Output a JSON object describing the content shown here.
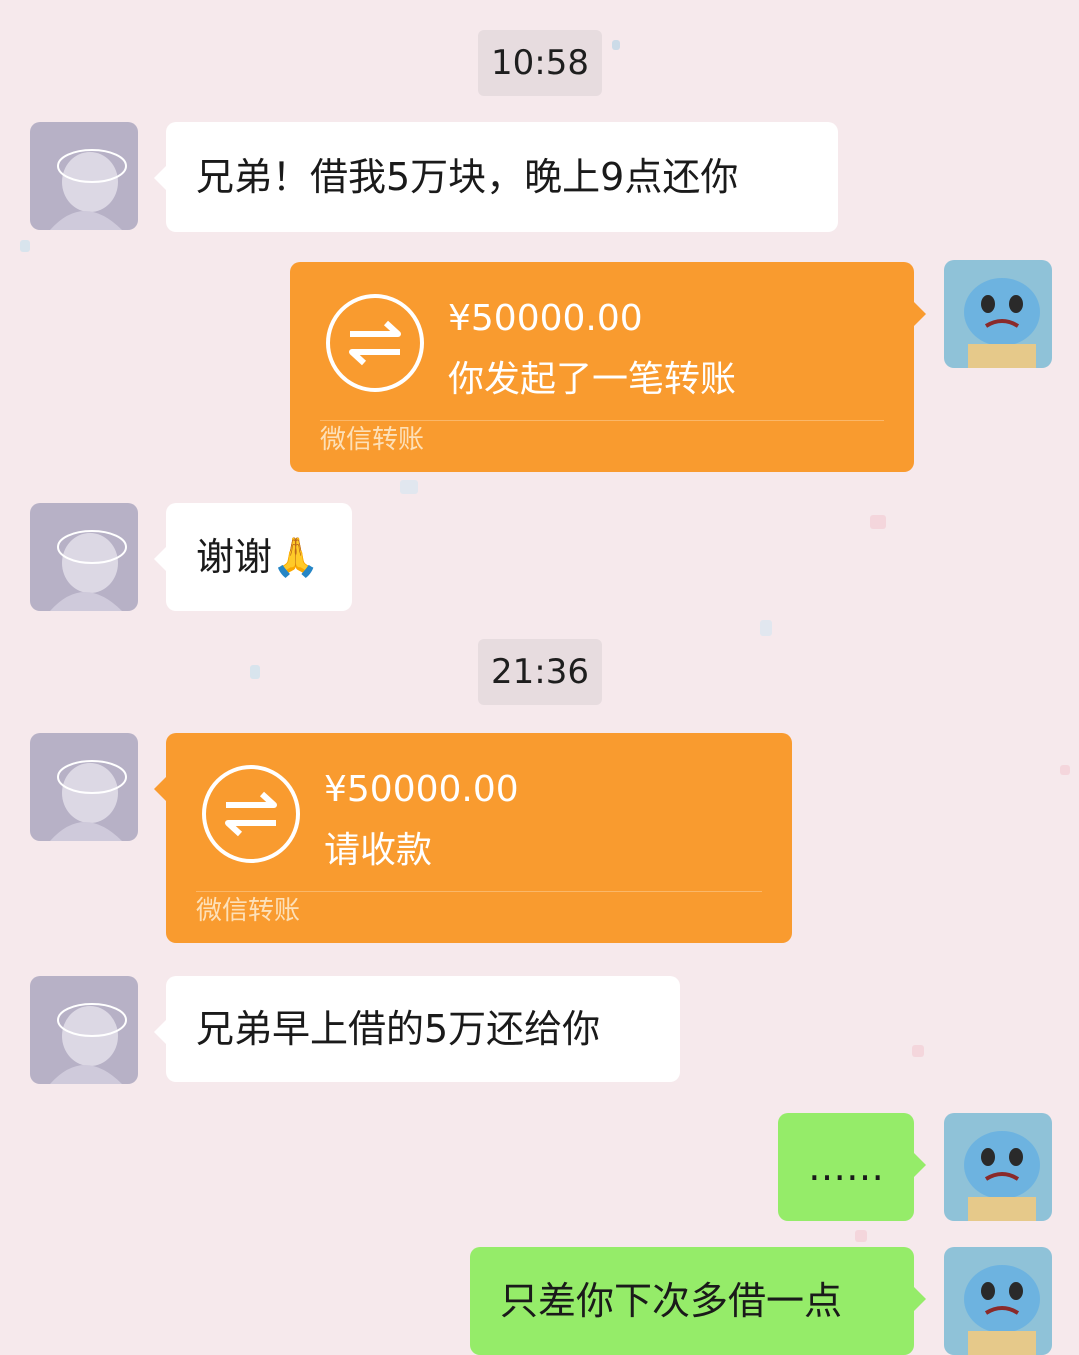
{
  "colors": {
    "background": "#f6e9ec",
    "incoming_bubble": "#ffffff",
    "outgoing_bubble": "#95ec69",
    "transfer_card": "#f99b2f"
  },
  "timestamps": [
    "10:58",
    "21:36"
  ],
  "messages": [
    {
      "from": "friend",
      "text": "兄弟！借我5万块，晚上9点还你"
    },
    {
      "from": "me",
      "type": "transfer",
      "amount": "¥50000.00",
      "desc": "你发起了一笔转账",
      "footer": "微信转账",
      "icon": "transfer-arrows-icon"
    },
    {
      "from": "friend",
      "text": "谢谢🙏"
    },
    {
      "from": "friend",
      "type": "transfer",
      "amount": "¥50000.00",
      "desc": "请收款",
      "footer": "微信转账",
      "icon": "transfer-arrows-icon"
    },
    {
      "from": "friend",
      "text": "兄弟早上借的5万还给你"
    },
    {
      "from": "me",
      "text": "……"
    },
    {
      "from": "me",
      "text": "只差你下次多借一点"
    }
  ]
}
